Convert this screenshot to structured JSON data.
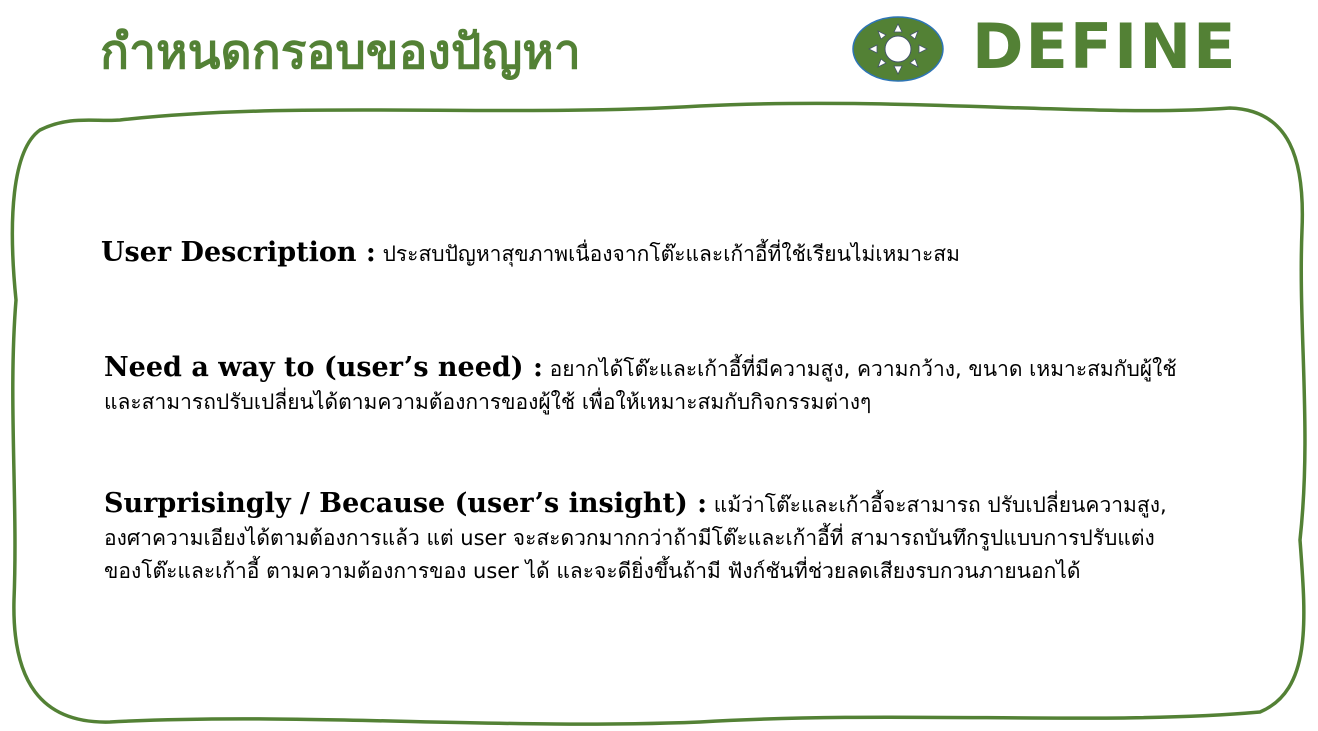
{
  "header": {
    "title": "กำหนดกรอบของปัญหา",
    "logo_label": "DEFINE",
    "logo_icon": "sun-icon",
    "accent_color": "#538135"
  },
  "sections": [
    {
      "label": "User Description :",
      "text": " ประสบปัญหาสุขภาพเนื่องจากโต๊ะและเก้าอี้ที่ใช้เรียนไม่เหมาะสม"
    },
    {
      "label": "Need a way to (user’s need) :",
      "text": " อยากได้โต๊ะและเก้าอี้ที่มีความสูง, ความกว้าง, ขนาด เหมาะสมกับผู้ใช้ และสามารถปรับเปลี่ยนได้ตามความต้องการของผู้ใช้ เพื่อให้เหมาะสมกับกิจกรรมต่างๆ"
    },
    {
      "label": "Surprisingly / Because (user’s insight) :",
      "text": " แม้ว่าโต๊ะและเก้าอี้จะสามารถ ปรับเปลี่ยนความสูง, องศาความเอียงได้ตามต้องการแล้ว แต่ user จะสะดวกมากกว่าถ้ามีโต๊ะและเก้าอี้ที่ สามารถบันทึกรูปแบบการปรับแต่งของโต๊ะและเก้าอี้ ตามความต้องการของ user ได้ และจะดียิ่งขึ้นถ้ามี ฟังก์ชันที่ช่วยลดเสียงรบกวนภายนอกได้"
    }
  ]
}
